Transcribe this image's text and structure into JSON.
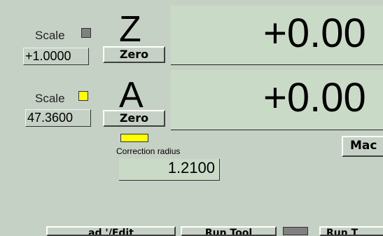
{
  "z_axis": {
    "scale_label": "Scale",
    "scale_value": "+1.0000",
    "letter": "Z",
    "zero_label": "Zero",
    "dro_value": "+0.00",
    "led_color": "#808080"
  },
  "a_axis": {
    "scale_label": "Scale",
    "scale_value": "47.3600",
    "letter": "A",
    "zero_label": "Zero",
    "dro_value": "+0.00",
    "led_color": "#ffff00"
  },
  "correction": {
    "label": "Correction radius",
    "value": "1.2100",
    "indicator_color": "#ffff00"
  },
  "buttons": {
    "mac_label": "Mac"
  },
  "bottom_bar": {
    "items": [
      "ad '/Edit",
      "Run Tool",
      "Run T"
    ]
  }
}
